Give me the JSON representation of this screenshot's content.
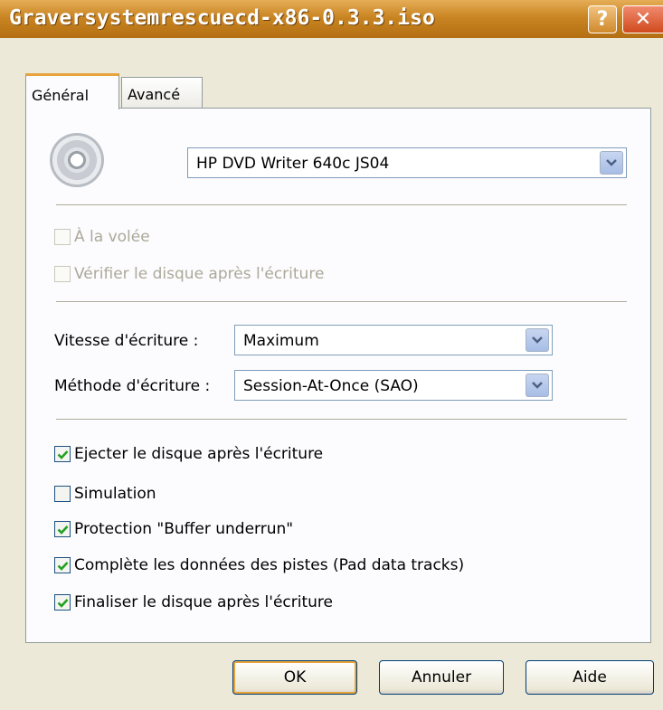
{
  "window": {
    "title": "Graversystemrescuecd-x86-0.3.3.iso",
    "help_label": "?",
    "close_label": "✕"
  },
  "tabs": [
    {
      "label": "Général",
      "active": true
    },
    {
      "label": "Avancé",
      "active": false
    }
  ],
  "device": {
    "icon": "cd-icon",
    "selected": "HP DVD Writer 640c JS04"
  },
  "options_top": [
    {
      "label": "À la volée",
      "checked": false,
      "enabled": false
    },
    {
      "label": "Vérifier le disque après l'écriture",
      "checked": false,
      "enabled": false
    }
  ],
  "write_speed": {
    "label": "Vitesse d'écriture :",
    "value": "Maximum"
  },
  "write_method": {
    "label": "Méthode d'écriture :",
    "value": "Session-At-Once (SAO)"
  },
  "options_bottom": [
    {
      "label": "Ejecter le disque après l'écriture",
      "checked": true,
      "enabled": true
    },
    {
      "label": "Simulation",
      "checked": false,
      "enabled": true
    },
    {
      "label": "Protection \"Buffer underrun\"",
      "checked": true,
      "enabled": true
    },
    {
      "label": "Complète les données des pistes (Pad data tracks)",
      "checked": true,
      "enabled": true
    },
    {
      "label": "Finaliser le disque après l'écriture",
      "checked": true,
      "enabled": true
    }
  ],
  "buttons": {
    "ok": "OK",
    "cancel": "Annuler",
    "help": "Aide"
  },
  "colors": {
    "titlebar": "#c98522",
    "dialog_bg": "#ece9d8",
    "check_mark": "#21a121",
    "tab_accent": "#e8a33c"
  }
}
